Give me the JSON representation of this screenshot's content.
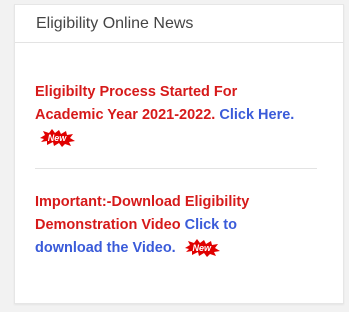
{
  "panel": {
    "title": "Eligibility Online News"
  },
  "news": [
    {
      "text": "Eligibilty Process Started For Academic Year 2021-2022.",
      "link_text": "Click Here.",
      "badge": "New"
    },
    {
      "text": "Important:-Download Eligibility Demonstration Video",
      "link_text": "Click to download the Video.",
      "badge": "New"
    }
  ],
  "colors": {
    "news_text": "#d61a1a",
    "link": "#3a5bd9",
    "badge_red": "#e00000"
  }
}
